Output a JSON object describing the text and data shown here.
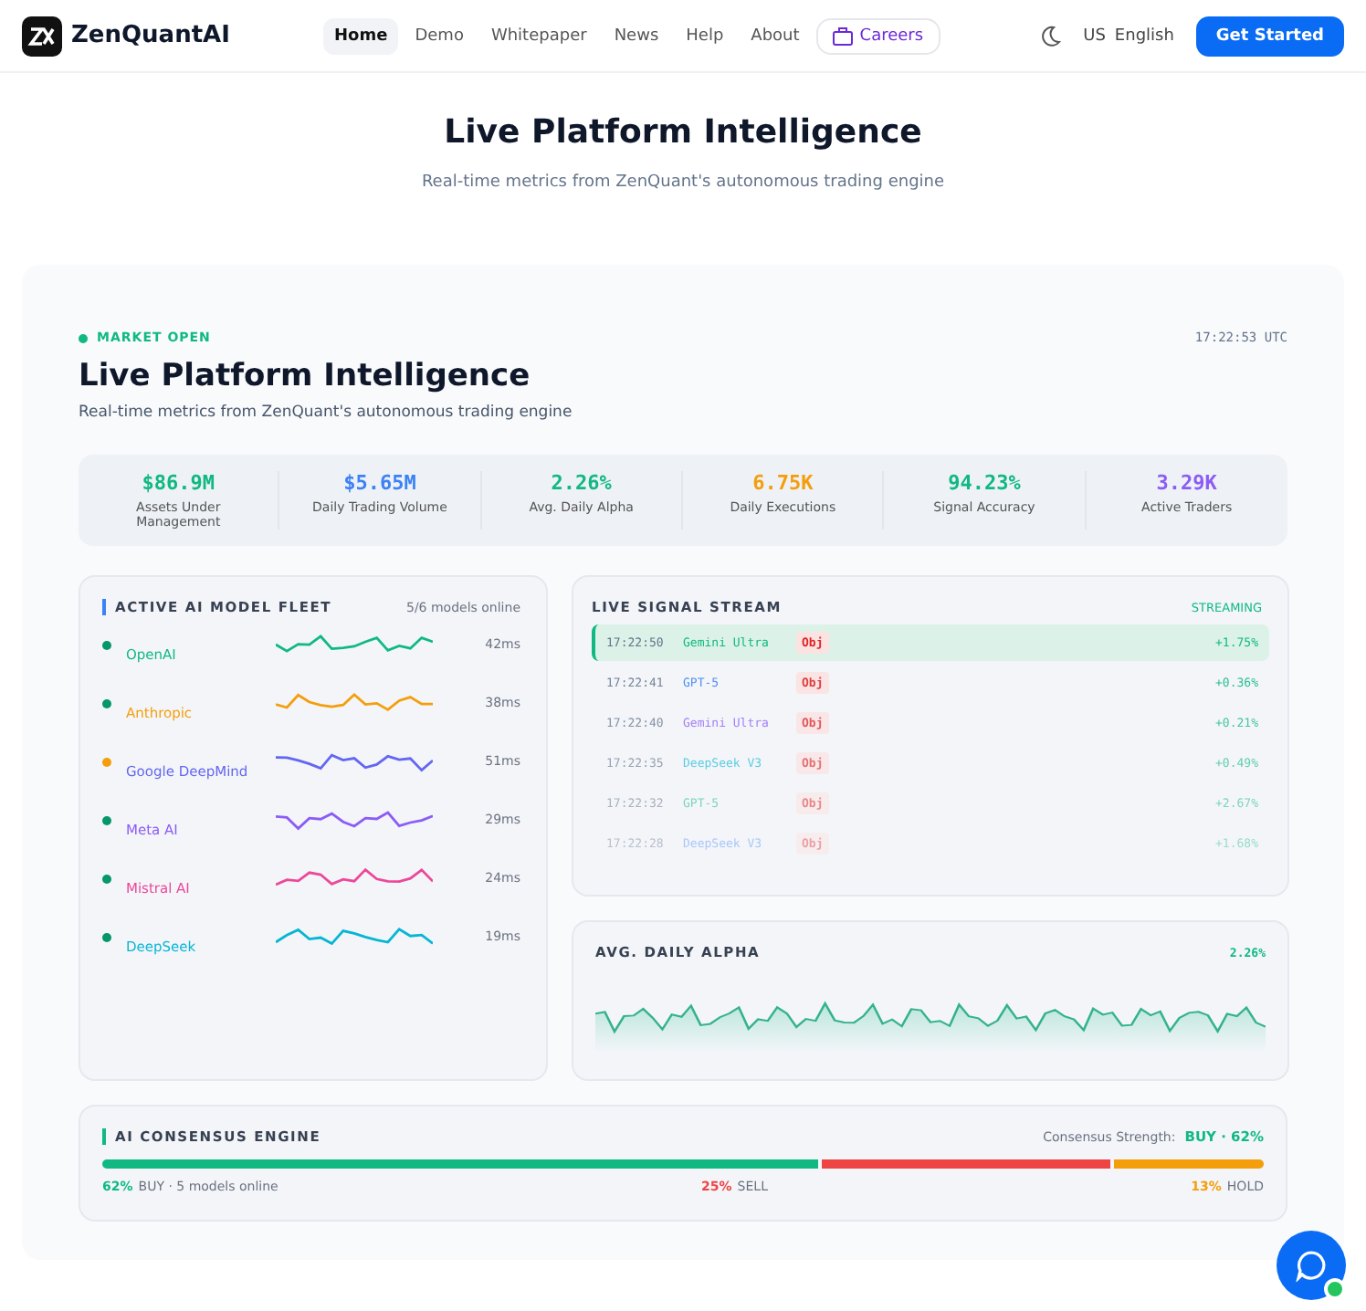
{
  "nav": {
    "brand": "ZenQuantAI",
    "links": [
      {
        "label": "Home",
        "selected": true
      },
      {
        "label": "Demo",
        "selected": false
      },
      {
        "label": "Whitepaper",
        "selected": false
      },
      {
        "label": "News",
        "selected": false
      },
      {
        "label": "Help",
        "selected": false
      },
      {
        "label": "About",
        "selected": false
      }
    ],
    "careers": "Careers",
    "lang_code": "US",
    "language": "English",
    "cta": "Get Started"
  },
  "hero": {
    "title": "Live Platform Intelligence",
    "subtitle": "Real-time metrics from ZenQuant's autonomous trading engine"
  },
  "panel": {
    "status": "MARKET OPEN",
    "time": "17:22:53 UTC",
    "title": "Live Platform Intelligence",
    "subtitle": "Real-time metrics from ZenQuant's autonomous trading engine",
    "stats": [
      {
        "value": "$86.9M",
        "label": "Assets Under Management",
        "color": "#10b981"
      },
      {
        "value": "$5.65M",
        "label": "Daily Trading Volume",
        "color": "#3b82f6"
      },
      {
        "value": "2.26%",
        "label": "Avg. Daily Alpha",
        "color": "#10b981"
      },
      {
        "value": "6.75K",
        "label": "Daily Executions",
        "color": "#f59e0b"
      },
      {
        "value": "94.23%",
        "label": "Signal Accuracy",
        "color": "#10b981"
      },
      {
        "value": "3.29K",
        "label": "Active Traders",
        "color": "#8b5cf6"
      }
    ]
  },
  "fleet": {
    "title": "ACTIVE AI MODEL FLEET",
    "count": "5/6 models online",
    "models": [
      {
        "provider": "OpenAI",
        "latency": "42ms",
        "color": "#10b981",
        "online": true
      },
      {
        "provider": "Anthropic",
        "latency": "38ms",
        "color": "#f59e0b",
        "online": true
      },
      {
        "provider": "Google DeepMind",
        "latency": "51ms",
        "color": "#6366f1",
        "online": false
      },
      {
        "provider": "Meta AI",
        "latency": "29ms",
        "color": "#8b5cf6",
        "online": true
      },
      {
        "provider": "Mistral AI",
        "latency": "24ms",
        "color": "#ec4899",
        "online": true
      },
      {
        "provider": "DeepSeek",
        "latency": "19ms",
        "color": "#06b6d4",
        "online": true
      }
    ]
  },
  "stream": {
    "title": "LIVE SIGNAL STREAM",
    "status": "STREAMING",
    "rows": [
      {
        "time": "17:22:50",
        "model": "Gemini Ultra",
        "tag": "Obj",
        "change": "+1.75%",
        "selected": true
      },
      {
        "time": "17:22:41",
        "model": "GPT-5",
        "tag": "Obj",
        "change": "+0.36%",
        "selected": false
      },
      {
        "time": "17:22:40",
        "model": "Gemini Ultra",
        "tag": "Obj",
        "change": "+0.21%",
        "selected": false
      },
      {
        "time": "17:22:35",
        "model": "DeepSeek V3",
        "tag": "Obj",
        "change": "+0.49%",
        "selected": false
      },
      {
        "time": "17:22:32",
        "model": "GPT-5",
        "tag": "Obj",
        "change": "+2.67%",
        "selected": false
      },
      {
        "time": "17:22:28",
        "model": "DeepSeek V3",
        "tag": "Obj",
        "change": "+1.68%",
        "selected": false
      }
    ]
  },
  "alpha": {
    "title": "AVG. DAILY ALPHA",
    "value": "2.26%"
  },
  "consensus": {
    "title": "AI CONSENSUS ENGINE",
    "strength_label": "Consensus Strength:",
    "strength_value": "BUY · 62%",
    "segments": [
      {
        "pct": "62%",
        "label": "BUY · 5 models online",
        "color": "#10b981"
      },
      {
        "pct": "25%",
        "label": "SELL",
        "color": "#ef4444"
      },
      {
        "pct": "13%",
        "label": "HOLD",
        "color": "#f59e0b"
      }
    ]
  }
}
